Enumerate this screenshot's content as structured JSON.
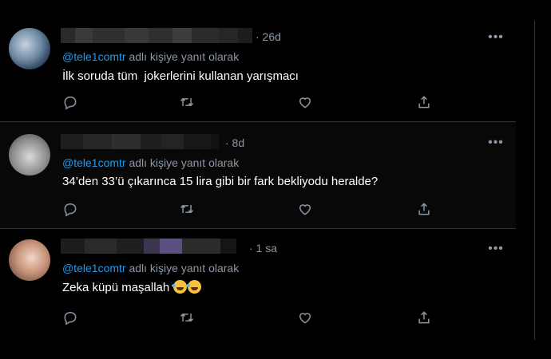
{
  "colors": {
    "background": "#000000",
    "text": "#e7e9ea",
    "muted": "#8b98a5",
    "link": "#1d9bf0",
    "divider": "#2f3336"
  },
  "tweets": [
    {
      "time": "· 26d",
      "reply_to_handle": "@tele1comtr",
      "reply_to_suffix": " adlı kişiye yanıt olarak",
      "text": "İlk soruda tüm  jokerlerini kullanan yarışmacı",
      "icons": [
        "reply-icon",
        "retweet-icon",
        "like-icon",
        "share-icon",
        "more-icon"
      ]
    },
    {
      "time": "· 8d",
      "reply_to_handle": "@tele1comtr",
      "reply_to_suffix": " adlı kişiye yanıt olarak",
      "text": "34’den 33’ü çıkarınca 15 lira gibi bir fark bekliyodu heralde?",
      "icons": [
        "reply-icon",
        "retweet-icon",
        "like-icon",
        "share-icon",
        "more-icon"
      ]
    },
    {
      "time": "· 1 sa",
      "reply_to_handle": "@tele1comtr",
      "reply_to_suffix": " adlı kişiye yanıt olarak",
      "text": "Zeka küpü maşallah ",
      "emoji": [
        "rolling-on-floor-laughing-emoji",
        "rolling-on-floor-laughing-emoji"
      ],
      "icons": [
        "reply-icon",
        "retweet-icon",
        "like-icon",
        "share-icon",
        "more-icon"
      ]
    }
  ]
}
